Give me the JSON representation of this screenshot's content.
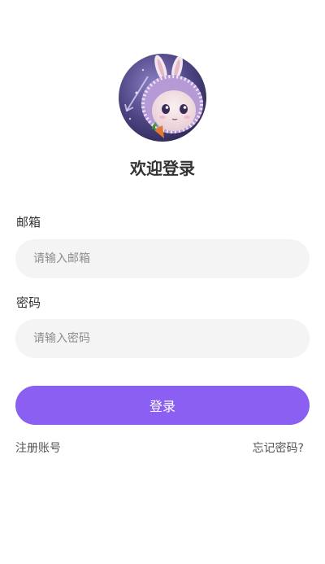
{
  "header": {
    "title": "欢迎登录"
  },
  "form": {
    "email": {
      "label": "邮箱",
      "placeholder": "请输入邮箱",
      "value": ""
    },
    "password": {
      "label": "密码",
      "placeholder": "请输入密码",
      "value": ""
    },
    "submit_label": "登录"
  },
  "links": {
    "register": "注册账号",
    "forgot_password": "忘记密码?"
  },
  "colors": {
    "primary": "#8a5ff2",
    "input_bg": "#f4f4f4",
    "text": "#333333",
    "placeholder": "#8d8d8d"
  },
  "icons": {
    "avatar": "bunny-avatar-image"
  }
}
